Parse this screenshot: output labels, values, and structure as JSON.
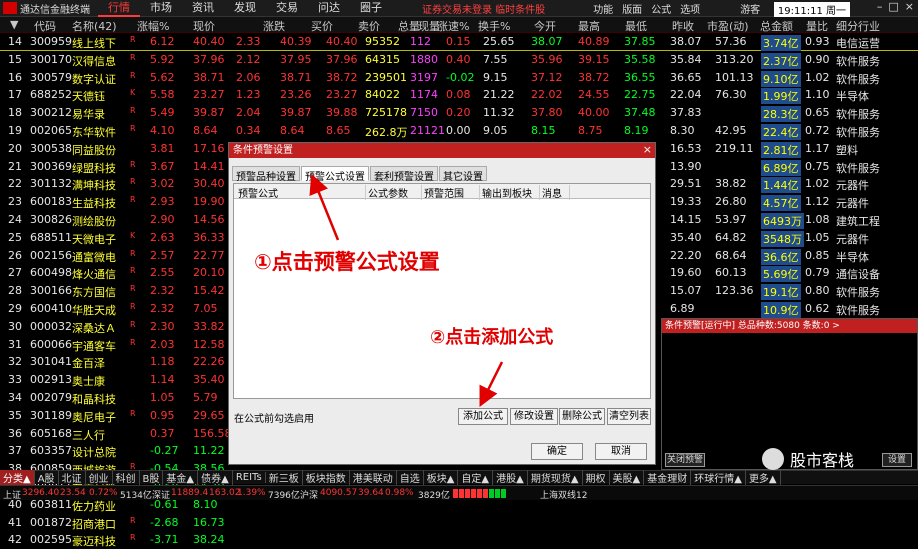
{
  "title": {
    "app_name": "通达信金融终端",
    "menus": [
      "行情",
      "市场",
      "资讯",
      "发现",
      "交易",
      "问达",
      "圈子"
    ],
    "notice": "证券交易未登录  临时条件股",
    "right_menus": [
      "功能",
      "版面",
      "公式",
      "选项"
    ],
    "guest": "游客",
    "time": "19:11:11 周一"
  },
  "columns": [
    "代码",
    "名称(42)",
    "涨幅%",
    "现价",
    "涨跌",
    "买价",
    "卖价",
    "总量",
    "现量",
    "涨速%",
    "换手%",
    "今开",
    "最高",
    "最低",
    "昨收",
    "市盈(动)",
    "总金额",
    "量比",
    "细分行业"
  ],
  "rows": [
    {
      "n": "14",
      "code": "300959",
      "name": "线上线下",
      "mk": "R",
      "pct": "6.12",
      "price": "40.40",
      "chg": "2.33",
      "bid": "40.39",
      "ask": "40.40",
      "vol": "95352",
      "cur": "112",
      "spd": "0.15",
      "turn": "25.65",
      "open": "38.07",
      "high": "40.89",
      "low": "37.85",
      "prev": "38.07",
      "pe": "57.36",
      "amt": "3.74亿",
      "lb": "0.93",
      "ind": "电信运营",
      "oc": "g",
      "hc": "r",
      "lc": "g",
      "sc": "r",
      "pc": "w",
      "turnc": "w",
      "hl": true
    },
    {
      "n": "15",
      "code": "300170",
      "name": "汉得信息",
      "mk": "R",
      "pct": "5.92",
      "price": "37.96",
      "chg": "2.12",
      "bid": "37.95",
      "ask": "37.96",
      "vol": "64315",
      "cur": "1880",
      "spd": "0.40",
      "turn": "7.55",
      "open": "35.96",
      "high": "39.15",
      "low": "35.58",
      "prev": "35.84",
      "pe": "313.20",
      "amt": "2.37亿",
      "lb": "0.90",
      "ind": "软件服务",
      "oc": "r",
      "hc": "r",
      "lc": "g",
      "sc": "r",
      "pc": "w",
      "turnc": "w"
    },
    {
      "n": "16",
      "code": "300579",
      "name": "数字认证",
      "mk": "R",
      "pct": "5.62",
      "price": "38.71",
      "chg": "2.06",
      "bid": "38.71",
      "ask": "38.72",
      "vol": "239501",
      "cur": "3197",
      "spd": "-0.02",
      "turn": "9.15",
      "open": "37.12",
      "high": "38.72",
      "low": "36.55",
      "prev": "36.65",
      "pe": "101.13",
      "amt": "9.10亿",
      "lb": "1.02",
      "ind": "软件服务",
      "oc": "r",
      "hc": "r",
      "lc": "g",
      "sc": "g",
      "pc": "w",
      "turnc": "w"
    },
    {
      "n": "17",
      "code": "688252",
      "name": "天德钰",
      "mk": "K",
      "pct": "5.58",
      "price": "23.27",
      "chg": "1.23",
      "bid": "23.26",
      "ask": "23.27",
      "vol": "84022",
      "cur": "1174",
      "spd": "0.08",
      "turn": "21.22",
      "open": "22.02",
      "high": "24.55",
      "low": "22.75",
      "prev": "22.04",
      "pe": "76.30",
      "amt": "1.99亿",
      "lb": "1.10",
      "ind": "半导体",
      "oc": "r",
      "hc": "r",
      "lc": "g",
      "sc": "r",
      "pc": "w",
      "turnc": "w"
    },
    {
      "n": "18",
      "code": "300212",
      "name": "易华录",
      "mk": "R",
      "pct": "5.49",
      "price": "39.87",
      "chg": "2.04",
      "bid": "39.87",
      "ask": "39.88",
      "vol": "725178",
      "cur": "7150",
      "spd": "0.20",
      "turn": "11.32",
      "open": "37.80",
      "high": "40.00",
      "low": "37.48",
      "prev": "37.83",
      "pe": "",
      "amt": "28.3亿",
      "lb": "0.65",
      "ind": "软件服务",
      "oc": "r",
      "hc": "r",
      "lc": "g",
      "sc": "r",
      "pc": "w",
      "turnc": "w"
    },
    {
      "n": "19",
      "code": "002065",
      "name": "东华软件",
      "mk": "R",
      "pct": "4.10",
      "price": "8.64",
      "chg": "0.34",
      "bid": "8.64",
      "ask": "8.65",
      "vol": "262.8万",
      "cur": "21121",
      "spd": "0.00",
      "turn": "9.05",
      "open": "8.15",
      "high": "8.75",
      "low": "8.19",
      "prev": "8.30",
      "pe": "42.95",
      "amt": "22.4亿",
      "lb": "0.72",
      "ind": "软件服务",
      "oc": "g",
      "hc": "r",
      "lc": "g",
      "sc": "w",
      "pc": "w",
      "turnc": "w"
    },
    {
      "n": "20",
      "code": "300538",
      "name": "同益股份",
      "mk": "",
      "pct": "3.81",
      "price": "17.16",
      "chg": "0.63",
      "bid": "17.16",
      "ask": "17.16",
      "vol": "166325",
      "cur": "2133",
      "spd": "-0.28",
      "turn": "14.89",
      "open": "15.65",
      "high": "17.55",
      "low": "16.00",
      "prev": "16.53",
      "pe": "219.11",
      "amt": "2.81亿",
      "lb": "1.17",
      "ind": "塑料",
      "oc": "g",
      "hc": "r",
      "lc": "g",
      "sc": "g",
      "pc": "w",
      "turnc": "w"
    },
    {
      "n": "21",
      "code": "300369",
      "name": "绿盟科技",
      "mk": "R",
      "pct": "3.67",
      "price": "14.41",
      "chg": "",
      "bid": "",
      "ask": "",
      "vol": "",
      "cur": "",
      "spd": "",
      "turn": "",
      "open": "",
      "high": "",
      "low": "",
      "prev": "13.90",
      "pe": "",
      "amt": "6.89亿",
      "lb": "0.75",
      "ind": "软件服务",
      "oc": "r",
      "hc": "r",
      "lc": "g",
      "sc": "r",
      "pc": "w",
      "turnc": "w"
    },
    {
      "n": "22",
      "code": "301132",
      "name": "满坤科技",
      "mk": "R",
      "pct": "3.02",
      "price": "30.40",
      "chg": "",
      "bid": "",
      "ask": "",
      "vol": "",
      "cur": "",
      "spd": "",
      "turn": "",
      "open": "",
      "high": "",
      "low": "",
      "prev": "29.51",
      "pe": "38.82",
      "amt": "1.44亿",
      "lb": "1.02",
      "ind": "元器件",
      "oc": "r",
      "hc": "r",
      "lc": "g",
      "sc": "r",
      "pc": "w",
      "turnc": "w"
    },
    {
      "n": "23",
      "code": "600183",
      "name": "生益科技",
      "mk": "R",
      "pct": "2.93",
      "price": "19.90",
      "chg": "",
      "bid": "",
      "ask": "",
      "vol": "",
      "cur": "",
      "spd": "",
      "turn": "",
      "open": "",
      "high": "",
      "low": "",
      "prev": "19.33",
      "pe": "26.80",
      "amt": "4.57亿",
      "lb": "1.12",
      "ind": "元器件",
      "oc": "r",
      "hc": "r",
      "lc": "g",
      "sc": "r",
      "pc": "w",
      "turnc": "w"
    },
    {
      "n": "24",
      "code": "300826",
      "name": "测绘股份",
      "mk": "",
      "pct": "2.90",
      "price": "14.56",
      "chg": "",
      "bid": "",
      "ask": "",
      "vol": "",
      "cur": "",
      "spd": "",
      "turn": "",
      "open": "",
      "high": "",
      "low": "",
      "prev": "14.15",
      "pe": "53.97",
      "amt": "6493万",
      "lb": "1.08",
      "ind": "建筑工程",
      "oc": "r",
      "hc": "r",
      "lc": "g",
      "sc": "r",
      "pc": "w",
      "turnc": "w"
    },
    {
      "n": "25",
      "code": "688511",
      "name": "天微电子",
      "mk": "K",
      "pct": "2.63",
      "price": "36.33",
      "chg": "",
      "bid": "",
      "ask": "",
      "vol": "",
      "cur": "",
      "spd": "",
      "turn": "",
      "open": "",
      "high": "",
      "low": "",
      "prev": "35.40",
      "pe": "64.82",
      "amt": "3548万",
      "lb": "1.05",
      "ind": "元器件",
      "oc": "r",
      "hc": "r",
      "lc": "g",
      "sc": "r",
      "pc": "w",
      "turnc": "w"
    },
    {
      "n": "26",
      "code": "002156",
      "name": "通富微电",
      "mk": "R",
      "pct": "2.57",
      "price": "22.77",
      "chg": "",
      "bid": "",
      "ask": "",
      "vol": "",
      "cur": "",
      "spd": "",
      "turn": "",
      "open": "",
      "high": "",
      "low": "",
      "prev": "22.20",
      "pe": "68.64",
      "amt": "36.6亿",
      "lb": "0.85",
      "ind": "半导体",
      "oc": "r",
      "hc": "r",
      "lc": "g",
      "sc": "r",
      "pc": "w",
      "turnc": "w"
    },
    {
      "n": "27",
      "code": "600498",
      "name": "烽火通信",
      "mk": "R",
      "pct": "2.55",
      "price": "20.10",
      "chg": "",
      "bid": "",
      "ask": "",
      "vol": "",
      "cur": "",
      "spd": "",
      "turn": "",
      "open": "",
      "high": "",
      "low": "",
      "prev": "19.60",
      "pe": "60.13",
      "amt": "5.69亿",
      "lb": "0.79",
      "ind": "通信设备",
      "oc": "r",
      "hc": "r",
      "lc": "g",
      "sc": "r",
      "pc": "w",
      "turnc": "w"
    },
    {
      "n": "28",
      "code": "300166",
      "name": "东方国信",
      "mk": "R",
      "pct": "2.32",
      "price": "15.42",
      "chg": "",
      "bid": "",
      "ask": "",
      "vol": "",
      "cur": "",
      "spd": "",
      "turn": "",
      "open": "",
      "high": "",
      "low": "",
      "prev": "15.07",
      "pe": "123.36",
      "amt": "19.1亿",
      "lb": "0.80",
      "ind": "软件服务",
      "oc": "r",
      "hc": "r",
      "lc": "g",
      "sc": "r",
      "pc": "w",
      "turnc": "w"
    },
    {
      "n": "29",
      "code": "600410",
      "name": "华胜天成",
      "mk": "R",
      "pct": "2.32",
      "price": "7.05",
      "chg": "",
      "bid": "",
      "ask": "",
      "vol": "",
      "cur": "",
      "spd": "",
      "turn": "",
      "open": "",
      "high": "",
      "low": "",
      "prev": "6.89",
      "pe": "",
      "amt": "10.9亿",
      "lb": "0.62",
      "ind": "软件服务",
      "oc": "r",
      "hc": "r",
      "lc": "g",
      "sc": "r",
      "pc": "w",
      "turnc": "w"
    },
    {
      "n": "30",
      "code": "000032",
      "name": "深桑达Ａ",
      "mk": "R",
      "pct": "2.30",
      "price": "33.82",
      "chg": "",
      "bid": "",
      "ask": "",
      "vol": "",
      "cur": "",
      "spd": "",
      "turn": "",
      "open": "",
      "high": "",
      "low": "",
      "prev": "33.06",
      "pe": "",
      "amt": "4.88亿",
      "lb": "0.67",
      "ind": "建筑工程",
      "oc": "r",
      "hc": "r",
      "lc": "g",
      "sc": "r",
      "pc": "w",
      "turnc": "w"
    },
    {
      "n": "31",
      "code": "600066",
      "name": "宇通客车",
      "mk": "R",
      "pct": "2.03",
      "price": "12.58",
      "chg": "",
      "bid": "",
      "ask": "",
      "vol": "",
      "cur": "",
      "spd": "",
      "turn": "",
      "open": "",
      "high": "",
      "low": "",
      "prev": "12.33",
      "pe": "36.69",
      "amt": "1.65亿",
      "lb": "0.88",
      "ind": "汽车整车",
      "oc": "r",
      "hc": "r",
      "lc": "g",
      "sc": "r",
      "pc": "w",
      "turnc": "w"
    },
    {
      "n": "32",
      "code": "301041",
      "name": "金百泽",
      "mk": "",
      "pct": "1.18",
      "price": "22.26",
      "chg": "",
      "bid": "",
      "ask": "",
      "vol": "",
      "cur": "",
      "spd": "",
      "turn": "",
      "open": "",
      "high": "",
      "low": "",
      "prev": "22.00",
      "pe": "71.96",
      "amt": "8016万",
      "lb": "0.97",
      "ind": "元器件",
      "oc": "r",
      "hc": "r",
      "lc": "g",
      "sc": "r",
      "pc": "w",
      "turnc": "w"
    },
    {
      "n": "33",
      "code": "002913",
      "name": "奥士康",
      "mk": "",
      "pct": "1.14",
      "price": "35.40",
      "chg": "",
      "bid": "",
      "ask": "",
      "vol": "",
      "cur": "",
      "spd": "",
      "turn": "",
      "open": "",
      "high": "",
      "low": "",
      "prev": "",
      "pe": "",
      "amt": "",
      "lb": "",
      "ind": "",
      "oc": "r",
      "hc": "r",
      "lc": "g",
      "sc": "r",
      "pc": "w",
      "turnc": "w"
    },
    {
      "n": "34",
      "code": "002079",
      "name": "和晶科技",
      "mk": "",
      "pct": "1.05",
      "price": "5.79",
      "chg": "",
      "bid": "",
      "ask": "",
      "vol": "",
      "cur": "",
      "spd": "",
      "turn": "",
      "open": "",
      "high": "",
      "low": "",
      "prev": "",
      "pe": "",
      "amt": "",
      "lb": "",
      "ind": "",
      "oc": "r",
      "hc": "r",
      "lc": "g",
      "sc": "r",
      "pc": "w",
      "turnc": "w"
    },
    {
      "n": "35",
      "code": "301189",
      "name": "奥尼电子",
      "mk": "R",
      "pct": "0.95",
      "price": "29.65",
      "chg": "",
      "bid": "",
      "ask": "",
      "vol": "",
      "cur": "",
      "spd": "",
      "turn": "",
      "open": "",
      "high": "",
      "low": "",
      "prev": "",
      "pe": "",
      "amt": "",
      "lb": "",
      "ind": "",
      "oc": "r",
      "hc": "r",
      "lc": "g",
      "sc": "r",
      "pc": "w",
      "turnc": "w"
    },
    {
      "n": "36",
      "code": "605168",
      "name": "三人行",
      "mk": "",
      "pct": "0.37",
      "price": "156.58",
      "chg": "",
      "bid": "",
      "ask": "",
      "vol": "",
      "cur": "",
      "spd": "",
      "turn": "",
      "open": "",
      "high": "",
      "low": "",
      "prev": "",
      "pe": "",
      "amt": "",
      "lb": "",
      "ind": "",
      "oc": "r",
      "hc": "r",
      "lc": "g",
      "sc": "r",
      "pc": "w",
      "turnc": "w"
    },
    {
      "n": "37",
      "code": "603357",
      "name": "设计总院",
      "mk": "",
      "pct": "-0.27",
      "price": "11.22",
      "chg": "",
      "bid": "",
      "ask": "",
      "vol": "",
      "cur": "",
      "spd": "",
      "turn": "",
      "open": "",
      "high": "",
      "low": "",
      "prev": "",
      "pe": "",
      "amt": "",
      "lb": "",
      "ind": "",
      "oc": "r",
      "hc": "r",
      "lc": "g",
      "sc": "r",
      "pc": "g",
      "turnc": "w"
    },
    {
      "n": "38",
      "code": "600859",
      "name": "西城旅游",
      "mk": "R",
      "pct": "-0.54",
      "price": "38.56",
      "chg": "",
      "bid": "",
      "ask": "",
      "vol": "",
      "cur": "",
      "spd": "",
      "turn": "",
      "open": "",
      "high": "",
      "low": "",
      "prev": "",
      "pe": "",
      "amt": "",
      "lb": "",
      "ind": "",
      "oc": "r",
      "hc": "r",
      "lc": "g",
      "sc": "r",
      "pc": "g",
      "turnc": "w"
    },
    {
      "n": "39",
      "code": "300811",
      "name": "东方材料",
      "mk": "",
      "pct": "-0.58",
      "price": "44.70",
      "chg": "",
      "bid": "",
      "ask": "",
      "vol": "",
      "cur": "",
      "spd": "",
      "turn": "",
      "open": "",
      "high": "",
      "low": "",
      "prev": "",
      "pe": "",
      "amt": "",
      "lb": "",
      "ind": "",
      "oc": "r",
      "hc": "r",
      "lc": "g",
      "sc": "r",
      "pc": "g",
      "turnc": "w"
    },
    {
      "n": "40",
      "code": "603811",
      "name": "佐力药业",
      "mk": "",
      "pct": "-0.61",
      "price": "8.10",
      "chg": "",
      "bid": "",
      "ask": "",
      "vol": "",
      "cur": "",
      "spd": "",
      "turn": "",
      "open": "",
      "high": "",
      "low": "",
      "prev": "",
      "pe": "",
      "amt": "",
      "lb": "",
      "ind": "",
      "oc": "r",
      "hc": "r",
      "lc": "g",
      "sc": "r",
      "pc": "g",
      "turnc": "w"
    },
    {
      "n": "41",
      "code": "001872",
      "name": "招商港口",
      "mk": "R",
      "pct": "-2.68",
      "price": "16.73",
      "chg": "",
      "bid": "",
      "ask": "",
      "vol": "",
      "cur": "",
      "spd": "",
      "turn": "",
      "open": "",
      "high": "",
      "low": "",
      "prev": "",
      "pe": "",
      "amt": "",
      "lb": "",
      "ind": "",
      "oc": "r",
      "hc": "r",
      "lc": "g",
      "sc": "r",
      "pc": "g",
      "turnc": "w"
    },
    {
      "n": "42",
      "code": "002595",
      "name": "豪迈科技",
      "mk": "R",
      "pct": "-3.71",
      "price": "38.24",
      "chg": "",
      "bid": "",
      "ask": "",
      "vol": "",
      "cur": "",
      "spd": "",
      "turn": "",
      "open": "",
      "high": "",
      "low": "",
      "prev": "",
      "pe": "",
      "amt": "",
      "lb": "",
      "ind": "",
      "oc": "r",
      "hc": "r",
      "lc": "g",
      "sc": "r",
      "pc": "g",
      "turnc": "w"
    }
  ],
  "dialog": {
    "title": "条件预警设置",
    "tabs": [
      "预警品种设置",
      "预警公式设置",
      "套利预警设置",
      "其它设置"
    ],
    "list_headers": [
      "预警公式",
      "公式参数",
      "预警范围",
      "输出到板块",
      "消息"
    ],
    "hint": "在公式前勾选启用",
    "buttons": {
      "add": "添加公式",
      "edit": "修改设置",
      "delete": "删除公式",
      "clear": "清空列表",
      "ok": "确定",
      "cancel": "取消"
    }
  },
  "annotations": {
    "step1": "①点击预警公式设置",
    "step2": "②点击添加公式"
  },
  "alert_panel": {
    "title": "条件预警[运行中] 总品种数:5080 条数:0  >",
    "close": "关闭预警",
    "settings": "设置"
  },
  "watermark": "股市客栈",
  "category_tabs": [
    "分类▲",
    "A股",
    "北证",
    "创业",
    "科创",
    "B股",
    "基金▲",
    "债券▲",
    "REITs",
    "新三板",
    "板块指数",
    "港美联动",
    "自选",
    "板块▲",
    "自定▲",
    "港股▲",
    "期货现货▲",
    "期权",
    "美股▲",
    "基金理财",
    "环球行情▲",
    "更多▲"
  ],
  "status": {
    "sh_label": "上证",
    "sh_index": "3296.40",
    "sh_chg": "23.54",
    "sh_pct": "0.72%",
    "sh_amt": "5134亿",
    "sz_label": "深证",
    "sz_index": "11889.4",
    "sz_chg": "163.02",
    "sz_pct": "1.39%",
    "sz_amt": "7396亿",
    "hs_label": "沪深",
    "hs_index": "4090.57",
    "hs_chg": "39.64",
    "hs_pct": "0.98%",
    "hs_amt": "3829亿",
    "exchange": "上海双线12"
  }
}
